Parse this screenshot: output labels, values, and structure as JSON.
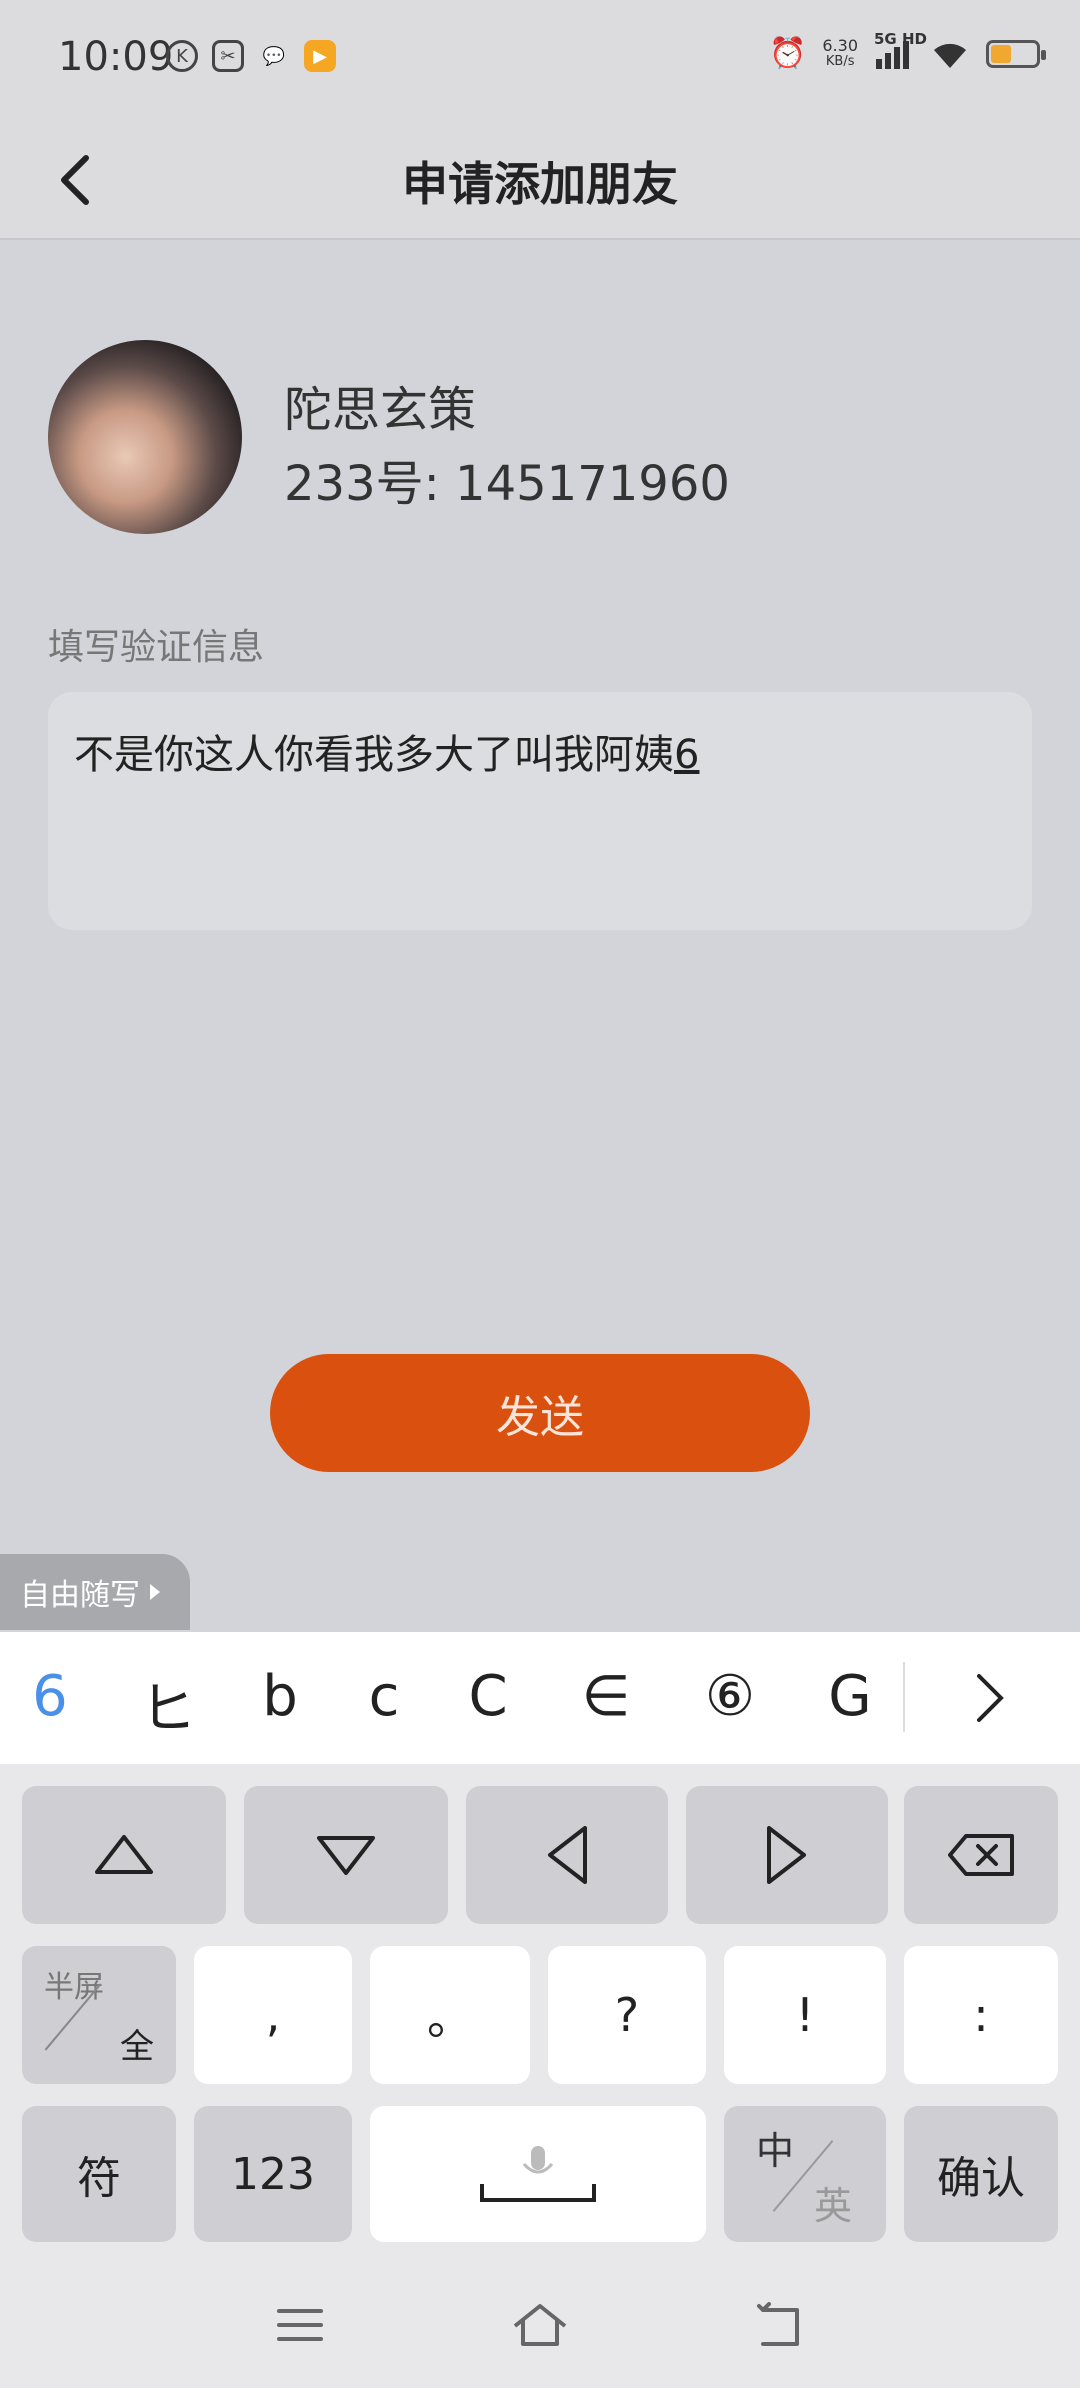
{
  "status_bar": {
    "time": "10:09",
    "net_speed_value": "6.30",
    "net_speed_unit": "KB/s",
    "signal_label": "5G HD",
    "battery_level": 0.45,
    "battery_color": "#f0a830"
  },
  "nav": {
    "title": "申请添加朋友",
    "back_icon": "chevron-left-icon"
  },
  "profile": {
    "name": "陀思玄策",
    "id_text": "233号: 145171960"
  },
  "verify": {
    "label": "填写验证信息",
    "message_text": "不是你这人你看我多大了叫我阿姨",
    "message_underlined": "6"
  },
  "send_button": {
    "label": "发送",
    "color": "#d9500f"
  },
  "freewrite_tab": {
    "label": "自由随写"
  },
  "candidates": [
    "6",
    "ヒ",
    "b",
    "c",
    "C",
    "∈",
    "⑥",
    "G"
  ],
  "keyboard": {
    "row1": [
      "up-arrow-icon",
      "down-arrow-icon",
      "left-arrow-icon",
      "right-arrow-icon",
      "backspace-icon"
    ],
    "punct": [
      ",",
      "。",
      "?",
      "!",
      ":"
    ],
    "half_top": "半屏",
    "half_bottom": "全",
    "symbol_key": "符",
    "num_key": "123",
    "zh_top": "中",
    "en_bottom": "英",
    "confirm_key": "确认"
  }
}
